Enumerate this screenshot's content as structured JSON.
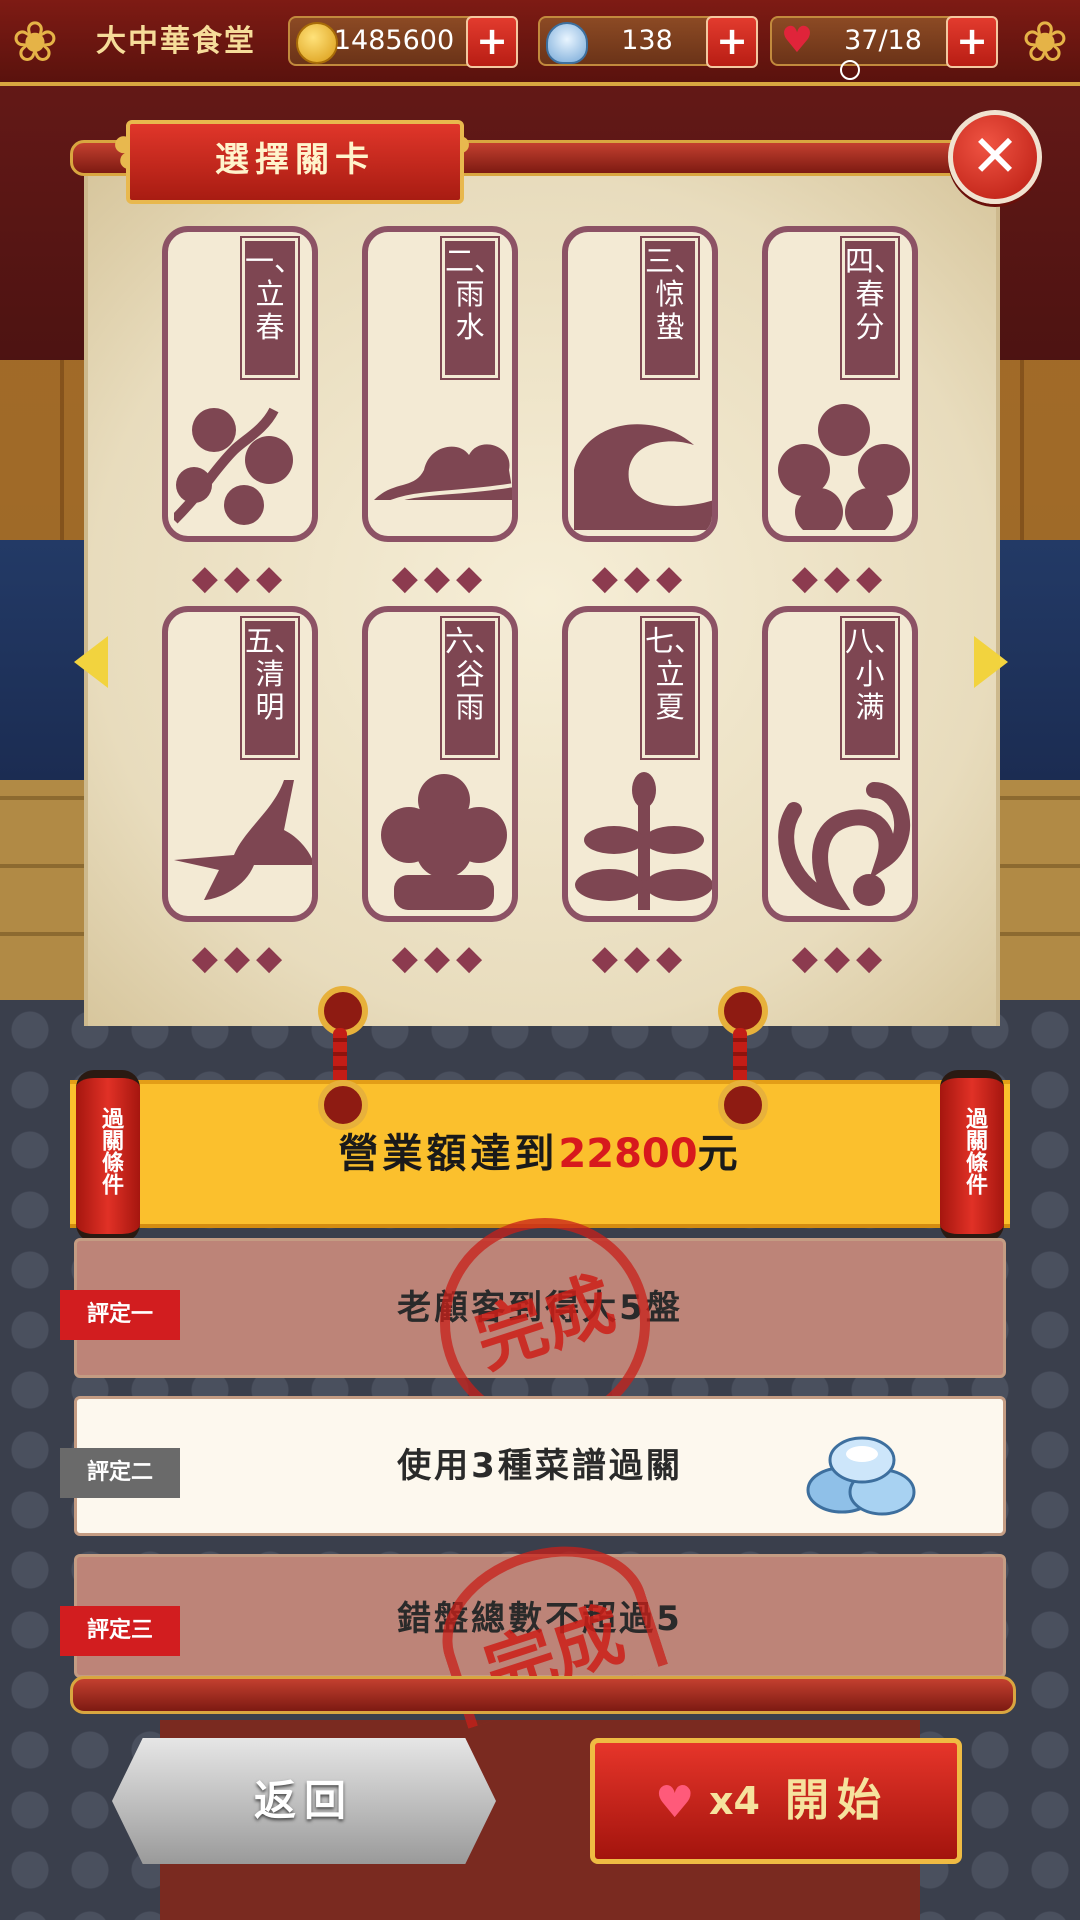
{
  "header": {
    "shop_name": "大中華食堂",
    "gold": "1485600",
    "silver": "138",
    "hearts": "37/18"
  },
  "panel": {
    "title": "選擇關卡"
  },
  "levels": [
    {
      "label": "一、立春",
      "art": "plum-branch"
    },
    {
      "label": "二、雨水",
      "art": "cloud"
    },
    {
      "label": "三、惊蛰",
      "art": "wave"
    },
    {
      "label": "四、春分",
      "art": "flower"
    },
    {
      "label": "五、清明",
      "art": "crane"
    },
    {
      "label": "六、谷雨",
      "art": "cloud-tree"
    },
    {
      "label": "七、立夏",
      "art": "lotus"
    },
    {
      "label": "八、小满",
      "art": "vine"
    }
  ],
  "diamonds": "◆◆◆",
  "conditions": {
    "lantern_text": "過關條件",
    "goal_prefix": "營業額達到",
    "goal_amount": "22800",
    "goal_suffix": "元"
  },
  "ratings": [
    {
      "tag": "評定一",
      "text": "老顧客到得大5盤",
      "status": "done",
      "stamp": "完成"
    },
    {
      "tag": "評定二",
      "text": "使用3種菜譜過關",
      "status": "open",
      "reward_icon": "silver-ingot-icon"
    },
    {
      "tag": "評定三",
      "text": "錯盤總數不超過5",
      "status": "done",
      "stamp": "完成"
    }
  ],
  "buttons": {
    "back": "返回",
    "start_cost": "x4",
    "start": "開始"
  },
  "colors": {
    "accent_red": "#d21d1f",
    "gold_trim": "#e8b84e",
    "card_maroon": "#7e4652",
    "goal_yellow": "#fbc02d"
  }
}
